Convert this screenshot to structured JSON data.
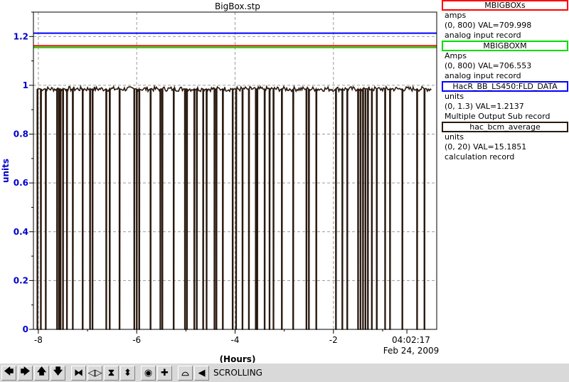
{
  "chart_data": {
    "type": "line",
    "title": "BigBox.stp",
    "xlabel": "(Hours)",
    "ylabel": "units",
    "xlim": [
      -8.1,
      0.1
    ],
    "ylim": [
      0,
      1.3
    ],
    "x_ticks": [
      -8,
      -6,
      -4,
      -2
    ],
    "x_tick_labels": [
      "-8",
      "-6",
      "-4",
      "-2"
    ],
    "y_ticks": [
      0,
      0.2,
      0.4,
      0.6,
      0.8,
      1,
      1.2
    ],
    "y_tick_labels": [
      "0",
      "0.2",
      "0.4",
      "0.6",
      "0.8",
      "1",
      "1.2"
    ],
    "end_time": "04:02:17",
    "end_date": "Feb 24, 2009",
    "grid": true,
    "legend_position": "right",
    "series": [
      {
        "name": "MBIGBOXs",
        "color": "#ff0000",
        "x": [
          -8.1,
          0
        ],
        "y": [
          1.162,
          1.162
        ]
      },
      {
        "name": "MBIGBOXM",
        "color": "#00dd00",
        "x": [
          -8.1,
          0
        ],
        "y": [
          1.155,
          1.155
        ]
      },
      {
        "name": "HacR_BB_LS450:FLD_DATA",
        "color": "#0000ff",
        "x": [
          -8.1,
          0
        ],
        "y": [
          1.2137,
          1.2137
        ]
      },
      {
        "name": "hac_bcm_average",
        "color": "#2a1a10",
        "baseline": 0.985,
        "dropouts": [
          -8.02,
          -7.95,
          -7.85,
          -7.62,
          -7.58,
          -7.55,
          -7.5,
          -7.42,
          -7.3,
          -7.1,
          -6.95,
          -6.9,
          -6.62,
          -6.55,
          -6.35,
          -6.05,
          -6.0,
          -5.95,
          -5.72,
          -5.52,
          -5.48,
          -5.25,
          -5.02,
          -4.98,
          -4.83,
          -4.78,
          -4.65,
          -4.58,
          -4.42,
          -4.38,
          -4.25,
          -4.05,
          -3.98,
          -3.85,
          -3.72,
          -3.58,
          -3.55,
          -3.4,
          -3.3,
          -3.22,
          -3.05,
          -2.82,
          -2.55,
          -2.5,
          -2.35,
          -1.95,
          -1.82,
          -1.72,
          -1.5,
          -1.45,
          -1.4,
          -1.35,
          -1.3,
          -1.22,
          -1.12,
          -0.95,
          -0.85,
          -0.6,
          -0.3,
          -0.15
        ]
      }
    ]
  },
  "legend": [
    {
      "name": "MBIGBOXs",
      "color": "#ff0000",
      "units": "amps",
      "range": "(0, 800) VAL=709.998",
      "record": "analog input record"
    },
    {
      "name": "MBIGBOXM",
      "color": "#00dd00",
      "units": "Amps",
      "range": "(0, 800) VAL=706.553",
      "record": "analog input record"
    },
    {
      "name": "HacR_BB_LS450:FLD_DATA",
      "color": "#0000ff",
      "units": "units",
      "range": "(0, 1.3) VAL=1.2137",
      "record": "Multiple Output Sub record"
    },
    {
      "name": "hac_bcm_average",
      "color": "#2a1a10",
      "units": "units",
      "range": "(0, 20) VAL=15.1851",
      "record": "calculation record"
    }
  ],
  "toolbar": {
    "buttons": [
      {
        "name": "pan-left-button",
        "icon": "arrow-left-icon",
        "glyph": "🡄"
      },
      {
        "name": "pan-right-button",
        "icon": "arrow-right-icon",
        "glyph": "🡆"
      },
      {
        "name": "pan-up-button",
        "icon": "arrow-up-icon",
        "glyph": "🡅"
      },
      {
        "name": "pan-down-button",
        "icon": "arrow-down-icon",
        "glyph": "🡇"
      },
      {
        "name": "zoom-in-x-button",
        "icon": "zoom-in-x-icon",
        "glyph": "⧓"
      },
      {
        "name": "zoom-out-x-button",
        "icon": "zoom-out-x-icon",
        "glyph": "◁▷"
      },
      {
        "name": "zoom-in-y-button",
        "icon": "zoom-in-y-icon",
        "glyph": "⧗"
      },
      {
        "name": "zoom-out-y-button",
        "icon": "zoom-out-y-icon",
        "glyph": "⬍"
      },
      {
        "name": "auto-scale-button",
        "icon": "target-icon",
        "glyph": "◉"
      },
      {
        "name": "zoom-button",
        "icon": "plus-icon",
        "glyph": "✚"
      },
      {
        "name": "reset-button",
        "icon": "reset-icon",
        "glyph": "⌓"
      },
      {
        "name": "scroll-mode-button",
        "icon": "scroll-icon",
        "glyph": "◀"
      }
    ],
    "mode_label": "SCROLLING"
  }
}
